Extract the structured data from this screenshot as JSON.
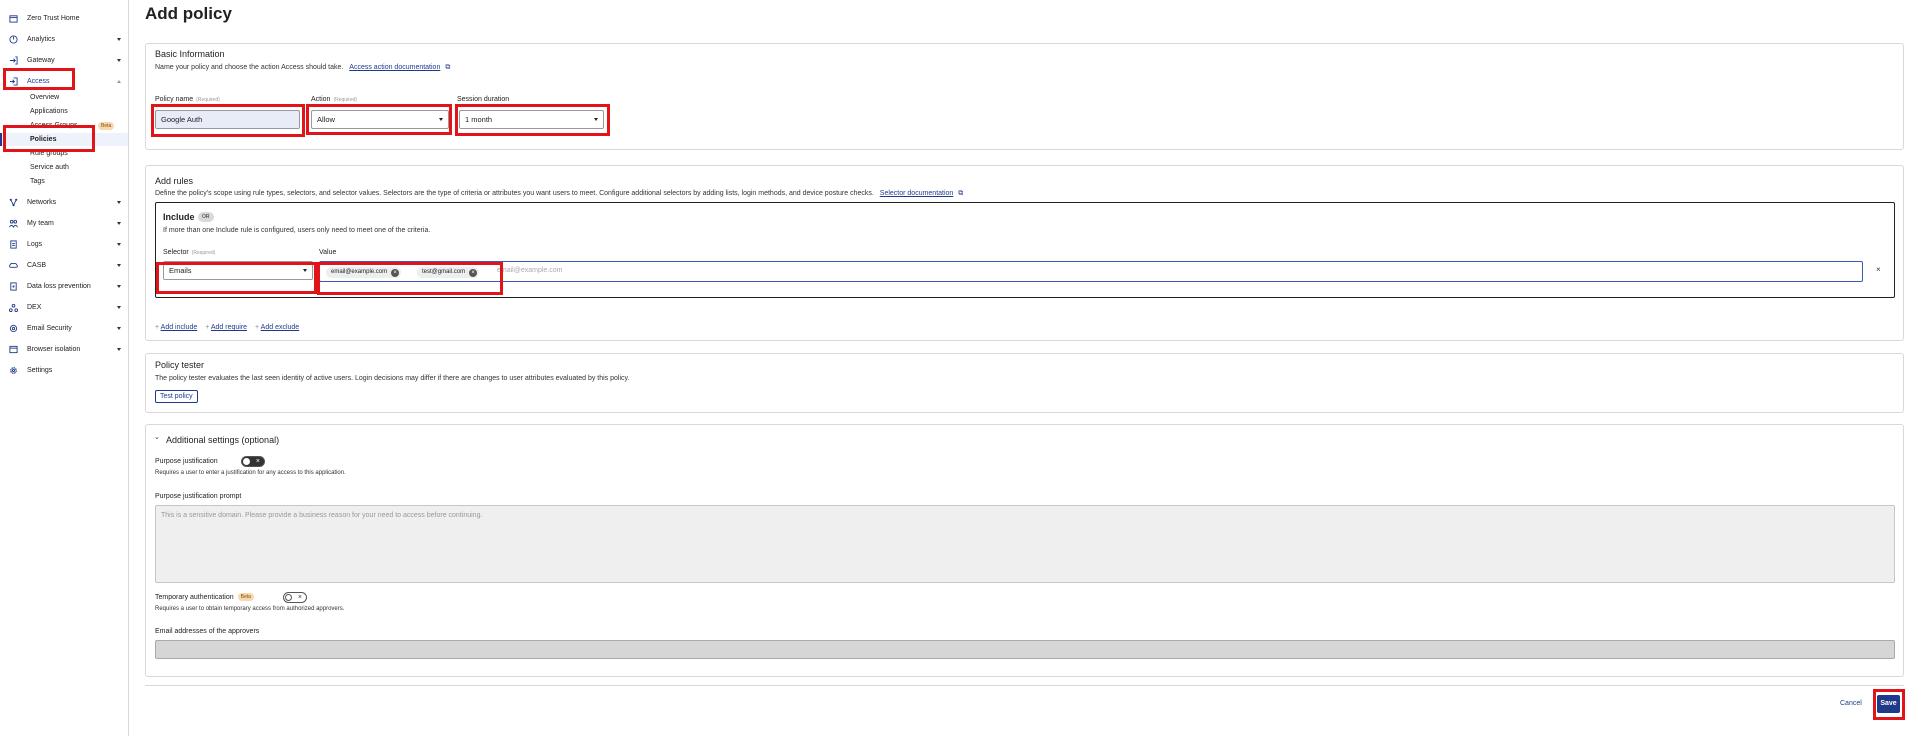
{
  "sidebar": {
    "items": [
      {
        "label": "Zero Trust Home",
        "icon": "home-icon"
      },
      {
        "label": "Analytics",
        "icon": "analytics-icon"
      },
      {
        "label": "Gateway",
        "icon": "gateway-icon"
      },
      {
        "label": "Access",
        "icon": "access-icon"
      },
      {
        "label": "Networks",
        "icon": "networks-icon"
      },
      {
        "label": "My team",
        "icon": "team-icon"
      },
      {
        "label": "Logs",
        "icon": "logs-icon"
      },
      {
        "label": "CASB",
        "icon": "casb-icon"
      },
      {
        "label": "Data loss prevention",
        "icon": "dlp-icon"
      },
      {
        "label": "DEX",
        "icon": "dex-icon"
      },
      {
        "label": "Email Security",
        "icon": "email-icon"
      },
      {
        "label": "Browser isolation",
        "icon": "browser-icon"
      },
      {
        "label": "Settings",
        "icon": "gear-icon"
      }
    ],
    "access_subitems": [
      {
        "label": "Overview"
      },
      {
        "label": "Applications"
      },
      {
        "label": "Access Groups"
      },
      {
        "label": "Policies"
      },
      {
        "label": "Rule groups"
      },
      {
        "label": "Service auth"
      },
      {
        "label": "Tags"
      }
    ],
    "beta_badge": "Beta"
  },
  "page": {
    "title": "Add policy"
  },
  "basic": {
    "title": "Basic Information",
    "description": "Name your policy and choose the action Access should take.",
    "doc_link": "Access action documentation",
    "policy_name_label": "Policy name",
    "required": "(Required)",
    "policy_name_value": "Google Auth",
    "action_label": "Action",
    "action_value": "Allow",
    "session_label": "Session duration",
    "session_value": "1 month"
  },
  "rules": {
    "title": "Add rules",
    "description": "Define the policy's scope using rule types, selectors, and selector values. Selectors are the type of criteria or attributes you want users to meet. Configure additional selectors by adding lists, login methods, and device posture checks.",
    "doc_link": "Selector documentation",
    "include_title": "Include",
    "or_badge": "OR",
    "include_desc": "If more than one Include rule is configured, users only need to meet one of the criteria.",
    "selector_label": "Selector",
    "selector_value": "Emails",
    "value_label": "Value",
    "chips": [
      "email@example.com",
      "test@gmail.com"
    ],
    "value_placeholder": "email@example.com",
    "add_include": "Add include",
    "add_require": "Add require",
    "add_exclude": "Add exclude"
  },
  "tester": {
    "title": "Policy tester",
    "description": "The policy tester evaluates the last seen identity of active users. Login decisions may differ if there are changes to user attributes evaluated by this policy.",
    "button": "Test policy"
  },
  "additional": {
    "title": "Additional settings (optional)",
    "purpose_label": "Purpose justification",
    "purpose_desc": "Requires a user to enter a justification for any access to this application.",
    "prompt_label": "Purpose justification prompt",
    "prompt_placeholder": "This is a sensitive domain. Please provide a business reason for your need to access before continuing.",
    "temp_label": "Temporary authentication",
    "temp_desc": "Requires a user to obtain temporary access from authorized approvers.",
    "approvers_label": "Email addresses of the approvers"
  },
  "footer": {
    "cancel": "Cancel",
    "save": "Save"
  },
  "colors": {
    "accent": "#1f3a8a",
    "highlight": "#e1141a",
    "save_bg": "#1f3a8a"
  }
}
